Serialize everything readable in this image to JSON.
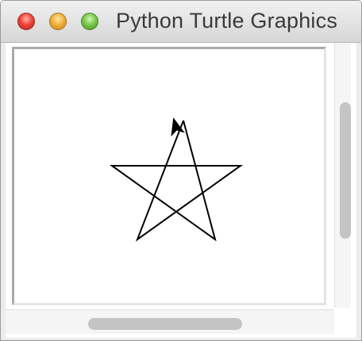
{
  "window": {
    "title": "Python Turtle Graphics"
  },
  "colors": {
    "pen": "#000000",
    "canvas_background": "#ffffff",
    "close": "#f0443a",
    "minimize": "#f2b13a",
    "maximize": "#7bc94c"
  },
  "canvas": {
    "drawing": "five-pointed star",
    "turtle_shape": "arrow"
  },
  "scrollbars": {
    "vertical_position": 0.5,
    "horizontal_position": 0.5
  }
}
